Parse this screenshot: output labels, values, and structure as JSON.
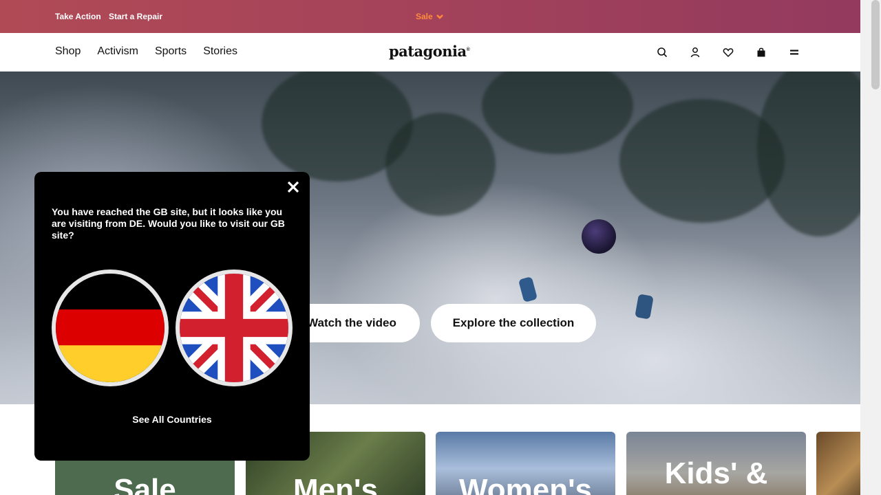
{
  "promo_bar": {
    "take_action": "Take Action",
    "start_repair": "Start a Repair",
    "sale": "Sale"
  },
  "nav": {
    "links": [
      "Shop",
      "Activism",
      "Sports",
      "Stories"
    ],
    "logo": "patagonia",
    "icons": [
      "search-icon",
      "account-icon",
      "heart-icon",
      "bag-icon",
      "menu-icon"
    ]
  },
  "hero": {
    "watch_button": "Watch the video",
    "explore_button": "Explore the collection"
  },
  "categories": [
    "Sale",
    "Men's",
    "Women's",
    "Kids' &",
    ""
  ],
  "modal": {
    "message": "You have reached the GB site, but it looks like you are visiting from DE. Would you like to visit our GB site?",
    "flags": [
      "germany-flag",
      "united-kingdom-flag"
    ],
    "see_all": "See All Countries"
  },
  "colors": {
    "promo_start": "#b04a55",
    "promo_end": "#933a5e",
    "sale_accent": "#ff8a3a",
    "modal_bg": "#000000"
  }
}
